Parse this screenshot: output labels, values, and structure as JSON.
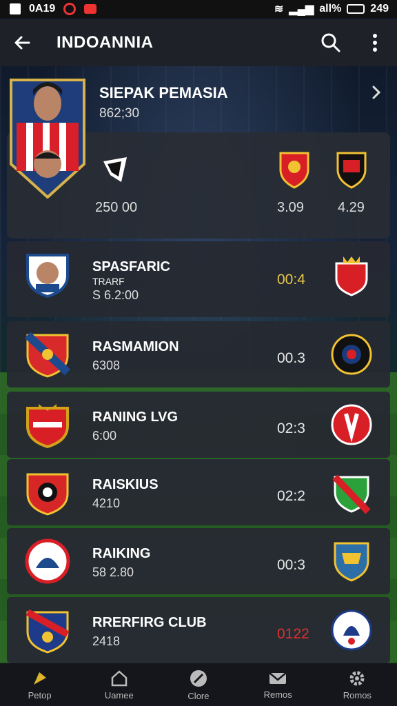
{
  "status_bar": {
    "left_text": "0A19",
    "right_text": "all% ",
    "battery": "249"
  },
  "app_bar": {
    "title": "INDOANNIA"
  },
  "featured": {
    "title": "SIEPAK PEMASIA",
    "subtitle": "862;30",
    "left_score": "250 00",
    "mid_score": "3.09",
    "right_score": "4.29"
  },
  "matches": [
    {
      "name": "SPASFARIC",
      "line2": "TRARF",
      "detail": "S 6.2:00",
      "time": "00:4",
      "time_color": "#e9c94a",
      "crest_color": "#1c4a8c",
      "opp_color": "#d81f26"
    },
    {
      "name": "RASMAMION",
      "detail": "6308",
      "time": "00.3",
      "time_color": "#e9e9e9",
      "crest_color": "#d8292b",
      "opp_color": "#1a3b7a"
    },
    {
      "name": "RANING LVG",
      "detail": "6:00",
      "time": "02:3",
      "time_color": "#e9e9e9",
      "crest_color": "#d1a21a",
      "opp_color": "#d81f26"
    },
    {
      "name": "RAISKIUS",
      "detail": "4210",
      "time": "02:2",
      "time_color": "#e9e9e9",
      "crest_color": "#d62626",
      "opp_color": "#2aa13a"
    },
    {
      "name": "RAIKING",
      "detail": "58 2.80",
      "time": "00:3",
      "time_color": "#e9e9e9",
      "crest_color": "#ffffff",
      "opp_color": "#2b6ea8"
    },
    {
      "name": "RRERFIRG CLUB",
      "detail": "2418",
      "time": "0122",
      "time_color": "#e03030",
      "crest_color": "#1e3b8a",
      "opp_color": "#ffffff"
    }
  ],
  "bottom_nav": [
    {
      "label": "Petop",
      "icon": "pin-icon"
    },
    {
      "label": "Uamee",
      "icon": "home-icon"
    },
    {
      "label": "Clore",
      "icon": "clock-icon"
    },
    {
      "label": "Remos",
      "icon": "mail-icon"
    },
    {
      "label": "Romos",
      "icon": "gear-icon"
    }
  ]
}
